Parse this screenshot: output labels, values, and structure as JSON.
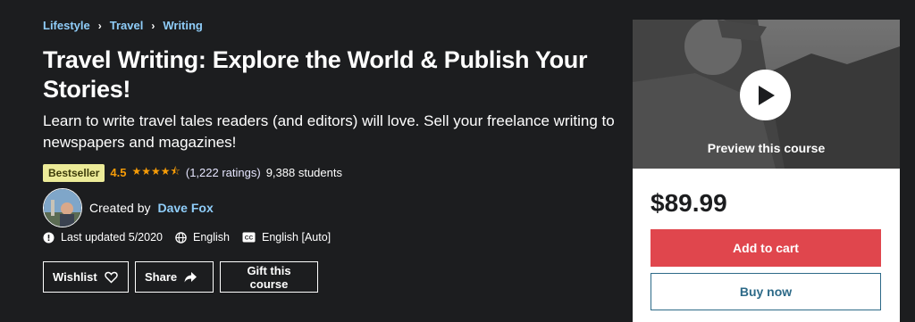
{
  "breadcrumb": [
    "Lifestyle",
    "Travel",
    "Writing"
  ],
  "course": {
    "title": "Travel Writing: Explore the World & Publish Your Stories!",
    "subtitle": "Learn to write travel tales readers (and editors) will love. Sell your freelance writing to newspapers and magazines!",
    "badge": "Bestseller",
    "rating": "4.5",
    "stars": "★★★★⯪",
    "ratings_count": "(1,222 ratings)",
    "students": "9,388 students",
    "created_by_label": "Created by",
    "author": "Dave Fox",
    "last_updated": "Last updated 5/2020",
    "language": "English",
    "captions": "English [Auto]"
  },
  "buttons": {
    "wishlist": "Wishlist",
    "share": "Share",
    "gift": "Gift this course"
  },
  "sidebar": {
    "preview_label": "Preview this course",
    "price": "$89.99",
    "add_to_cart": "Add to cart",
    "buy_now": "Buy now"
  },
  "colors": {
    "background": "#1c1d1f",
    "link": "#8fcdf9",
    "badge": "#eceb98",
    "star": "#f69c08",
    "add_to_cart": "#e0464d",
    "buy_now_border": "#2d6a88"
  }
}
